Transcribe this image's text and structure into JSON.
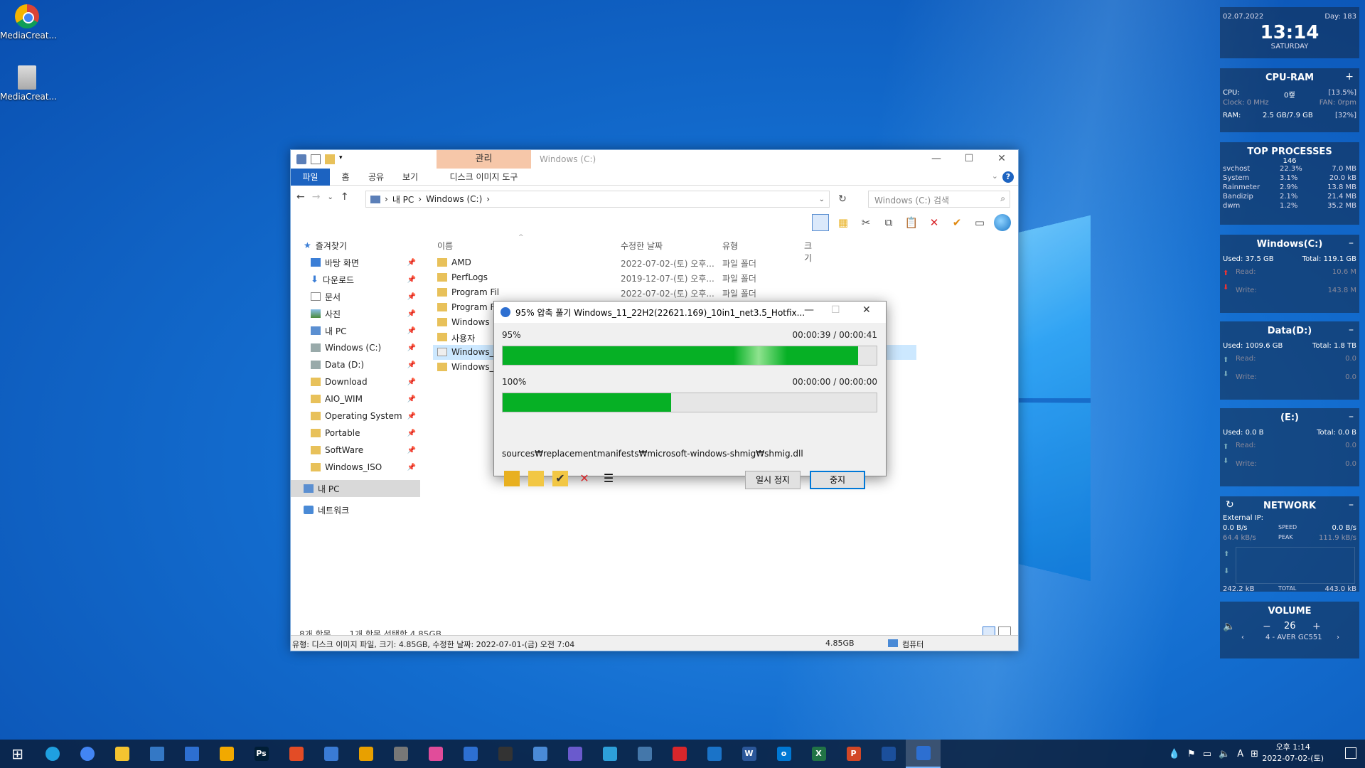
{
  "desktop": {
    "icons": [
      {
        "label": "MediaCreat...",
        "icon": "chrome-app-icon"
      },
      {
        "label": "MediaCreat...",
        "icon": "file-icon"
      }
    ]
  },
  "explorer": {
    "quick_access_dropdown": "▾",
    "manage_tab": "관리",
    "title": "Windows (C:)",
    "ribbon_tabs": [
      "파일",
      "홈",
      "공유",
      "보기",
      "디스크 이미지 도구"
    ],
    "breadcrumb": [
      "내 PC",
      "Windows (C:)"
    ],
    "breadcrumb_sep": "›",
    "search_placeholder": "Windows (C:) 검색",
    "sidebar": [
      {
        "label": "즐겨찾기",
        "icon": "star-icon",
        "top": true
      },
      {
        "label": "바탕 화면",
        "icon": "desktop-icon",
        "pinned": true
      },
      {
        "label": "다운로드",
        "icon": "download-icon",
        "pinned": true
      },
      {
        "label": "문서",
        "icon": "document-icon",
        "pinned": true
      },
      {
        "label": "사진",
        "icon": "picture-icon",
        "pinned": true
      },
      {
        "label": "내 PC",
        "icon": "pc-icon",
        "pinned": true
      },
      {
        "label": "Windows (C:)",
        "icon": "drive-icon",
        "pinned": true
      },
      {
        "label": "Data (D:)",
        "icon": "drive-icon",
        "pinned": true
      },
      {
        "label": "Download",
        "icon": "folder-icon",
        "pinned": true
      },
      {
        "label": "AIO_WIM",
        "icon": "folder-icon",
        "pinned": true
      },
      {
        "label": "Operating System",
        "icon": "folder-icon",
        "pinned": true
      },
      {
        "label": "Portable",
        "icon": "folder-icon",
        "pinned": true
      },
      {
        "label": "SoftWare",
        "icon": "folder-icon",
        "pinned": true
      },
      {
        "label": "Windows_ISO",
        "icon": "folder-icon",
        "pinned": true
      },
      {
        "label": "내 PC",
        "icon": "pc-icon",
        "top": true,
        "selected": true
      },
      {
        "label": "네트워크",
        "icon": "network-icon",
        "top": true
      }
    ],
    "pin_glyph": "📌",
    "columns": {
      "name": "이름",
      "date": "수정한 날짜",
      "type": "유형",
      "size": "크기"
    },
    "files": [
      {
        "name": "AMD",
        "date": "2022-07-02-(토) 오후...",
        "type": "파일 폴더"
      },
      {
        "name": "PerfLogs",
        "date": "2019-12-07-(토) 오후...",
        "type": "파일 폴더"
      },
      {
        "name": "Program Files",
        "date": "2022-07-02-(토) 오후...",
        "type": "파일 폴더"
      },
      {
        "name": "Program Fil",
        "date": "",
        "type": ""
      },
      {
        "name": "Windows",
        "date": "",
        "type": ""
      },
      {
        "name": "사용자",
        "date": "",
        "type": ""
      },
      {
        "name": "Windows_1",
        "date": "",
        "type": "",
        "selected": true,
        "iso": true
      },
      {
        "name": "Windows_1",
        "date": "",
        "type": ""
      }
    ],
    "status_count": "8개 항목",
    "status_selected": "1개 항목 선택함 4.85GB",
    "status_detail": "유형: 디스크 이미지 파일, 크기: 4.85GB, 수정한 날짜: 2022-07-01-(금) 오전 7:04",
    "status_size": "4.85GB",
    "status_location": "컴퓨터"
  },
  "dialog": {
    "title": "95% 압축 풀기 Windows_11_22H2(22621.169)_10in1_net3.5_Hotfix...",
    "progress1": {
      "percent_label": "95%",
      "value": 95,
      "time": "00:00:39 / 00:00:41"
    },
    "progress2": {
      "percent_label": "100%",
      "value": 45,
      "time": "00:00:00 / 00:00:00"
    },
    "current_file": "sources₩replacementmanifests₩microsoft-windows-shmig₩shmig.dll",
    "pause_label": "일시 정지",
    "stop_label": "중지"
  },
  "rainmeter": {
    "clock": {
      "date": "02.07.2022",
      "day": "Day: 183",
      "time": "13:14",
      "weekday": "SATURDAY"
    },
    "cpuram": {
      "title": "CPU-RAM",
      "cpu_label": "CPU:",
      "cpu_val": "0캪",
      "cpu_pct": "[13.5%]",
      "clock_label": "Clock: 0 MHz",
      "fan_label": "FAN: 0rpm",
      "ram_label": "RAM:",
      "ram_val": "2.5 GB/7.9 GB",
      "ram_pct": "[32%]"
    },
    "top": {
      "title": "TOP PROCESSES",
      "count": "146",
      "rows": [
        {
          "name": "svchost",
          "cpu": "22.3%",
          "mem": "7.0 MB"
        },
        {
          "name": "System",
          "cpu": "3.1%",
          "mem": "20.0 kB"
        },
        {
          "name": "Rainmeter",
          "cpu": "2.9%",
          "mem": "13.8 MB"
        },
        {
          "name": "Bandizip",
          "cpu": "2.1%",
          "mem": "21.4 MB"
        },
        {
          "name": "dwm",
          "cpu": "1.2%",
          "mem": "35.2 MB"
        }
      ]
    },
    "drives": [
      {
        "title": "Windows(C:)",
        "used": "Used: 37.5 GB",
        "total": "Total: 119.1 GB",
        "read": "10.6 M",
        "write": "143.8 M"
      },
      {
        "title": "Data(D:)",
        "used": "Used: 1009.6 GB",
        "total": "Total: 1.8 TB",
        "read": "0.0",
        "write": "0.0"
      },
      {
        "title": "(E:)",
        "used": "Used: 0.0 B",
        "total": "Total: 0.0 B",
        "read": "0.0",
        "write": "0.0"
      }
    ],
    "read_label": "Read:",
    "write_label": "Write:",
    "network": {
      "title": "NETWORK",
      "external": "External IP:",
      "down": "0.0 B/s",
      "speed": "SPEED",
      "up": "0.0 B/s",
      "down2": "64.4 kB/s",
      "peak": "PEAK",
      "up2": "111.9 kB/s",
      "total_down": "242.2 kB",
      "total": "TOTAL",
      "total_up": "443.0 kB"
    },
    "volume": {
      "title": "VOLUME",
      "minus": "−",
      "value": "26",
      "plus": "+",
      "device": "4 - AVER GC551",
      "prev": "‹",
      "next": "›"
    }
  },
  "taskbar": {
    "apps": [
      "start-icon",
      "edge-icon",
      "chrome-icon",
      "explorer-icon",
      "store-icon",
      "mail-icon",
      "app-icon",
      "photoshop-icon",
      "app-icon",
      "app-icon",
      "app-icon",
      "app-icon",
      "app-icon",
      "app-icon",
      "app-icon",
      "app-icon",
      "app-icon",
      "app-icon",
      "app-icon",
      "acrobat-icon",
      "app-icon",
      "word-icon",
      "outlook-icon",
      "excel-icon",
      "powerpoint-icon",
      "shield-icon",
      "bandizip-icon"
    ],
    "photoshop": "Ps",
    "word": "W",
    "excel": "X",
    "powerpoint": "P",
    "outlook": "o",
    "ime": "A",
    "clock_time": "오후 1:14",
    "clock_date": "2022-07-02-(토)"
  }
}
